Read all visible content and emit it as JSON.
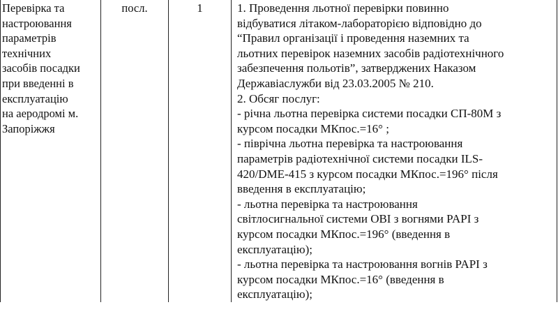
{
  "row": {
    "service_name": "Перевірка та\nнастроювання\nпараметрів\nтехнічних\nзасобів посадки\nпри введенні в\nексплуатацію\nна аеродромі м.\nЗапоріжжя",
    "unit": "посл.",
    "quantity": "1",
    "description_lines": [
      "1. Проведення льотної перевірки повинно",
      "відбуватися літаком-лабораторією відповідно до",
      "“Правил організації і проведення наземних та",
      "льотних перевірок наземних засобів радіотехнічного",
      "забезпечення польотів”, затверджених Наказом",
      "Державіаслужби від 23.03.2005 № 210.",
      "2. Обсяг послуг:",
      "- річна льотна перевірка системи посадки СП-80М з",
      "курсом посадки МКпос.=16°  ;",
      "- піврічна льотна перевірка та настроювання",
      "параметрів радіотехнічної системи посадки ILS-",
      "420/DME-415 з курсом посадки МКпос.=196° після",
      "введення в експлуатацію;",
      "- льотна перевірка та настроювання",
      "світлосигнальної системи OBI з вогнями PAPI з",
      "курсом посадки МКпос.=196° (введення в",
      "експлуатацію);",
      "- льотна перевірка та настроювання  вогнів PAPI з",
      "курсом посадки МКпос.=16° (введення в",
      "експлуатацію);"
    ]
  }
}
